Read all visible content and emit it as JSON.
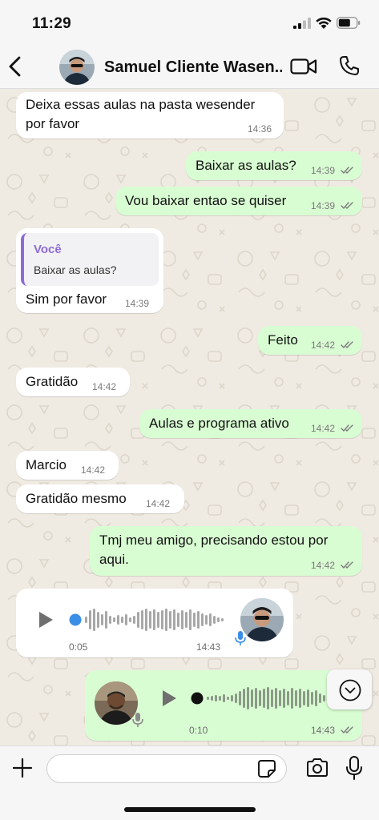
{
  "status_bar": {
    "time": "11:29"
  },
  "header": {
    "contact_name": "Samuel Cliente Wasen...",
    "icons": [
      "back-chevron-icon",
      "video-call-icon",
      "phone-call-icon"
    ]
  },
  "messages": [
    {
      "id": "m1",
      "direction": "incoming",
      "lines": [
        "Deixa essas aulas na pasta wesender",
        "por favor"
      ],
      "time": "14:36"
    },
    {
      "id": "m2",
      "direction": "outgoing",
      "text": "Baixar as aulas?",
      "time": "14:39",
      "read": true
    },
    {
      "id": "m3",
      "direction": "outgoing",
      "text": "Vou baixar entao se quiser",
      "time": "14:39",
      "read": true
    },
    {
      "id": "m4",
      "direction": "incoming",
      "quote": {
        "author": "Você",
        "text": "Baixar as aulas?"
      },
      "text": "Sim por favor",
      "time": "14:39"
    },
    {
      "id": "m5",
      "direction": "outgoing",
      "text": "Feito",
      "time": "14:42",
      "read": true
    },
    {
      "id": "m6",
      "direction": "incoming",
      "text": "Gratidão",
      "time": "14:42"
    },
    {
      "id": "m7",
      "direction": "outgoing",
      "text": "Aulas e programa ativo",
      "time": "14:42",
      "read": true
    },
    {
      "id": "m8",
      "direction": "incoming",
      "text": "Marcio",
      "time": "14:42"
    },
    {
      "id": "m9",
      "direction": "incoming",
      "text": "Gratidão mesmo",
      "time": "14:42"
    },
    {
      "id": "m10",
      "direction": "outgoing",
      "lines": [
        "Tmj meu amigo, precisando estou por",
        "aqui."
      ],
      "time": "14:42",
      "read": true
    },
    {
      "id": "m11",
      "direction": "incoming",
      "type": "voice",
      "duration": "0:05",
      "time": "14:43"
    },
    {
      "id": "m12",
      "direction": "outgoing",
      "type": "voice",
      "duration": "0:10",
      "time": "14:43",
      "read": true
    }
  ],
  "input_bar": {
    "placeholder": "",
    "icons": [
      "plus-icon",
      "sticker-icon",
      "camera-icon",
      "microphone-icon"
    ]
  },
  "colors": {
    "incoming_bubble": "#ffffff",
    "outgoing_bubble": "#d9fdd3",
    "chat_background": "#efeae2",
    "read_ticks": "#7a7a7a",
    "quote_accent": "#8e6bd6",
    "voice_unplayed_dot": "#3a8ee6"
  }
}
